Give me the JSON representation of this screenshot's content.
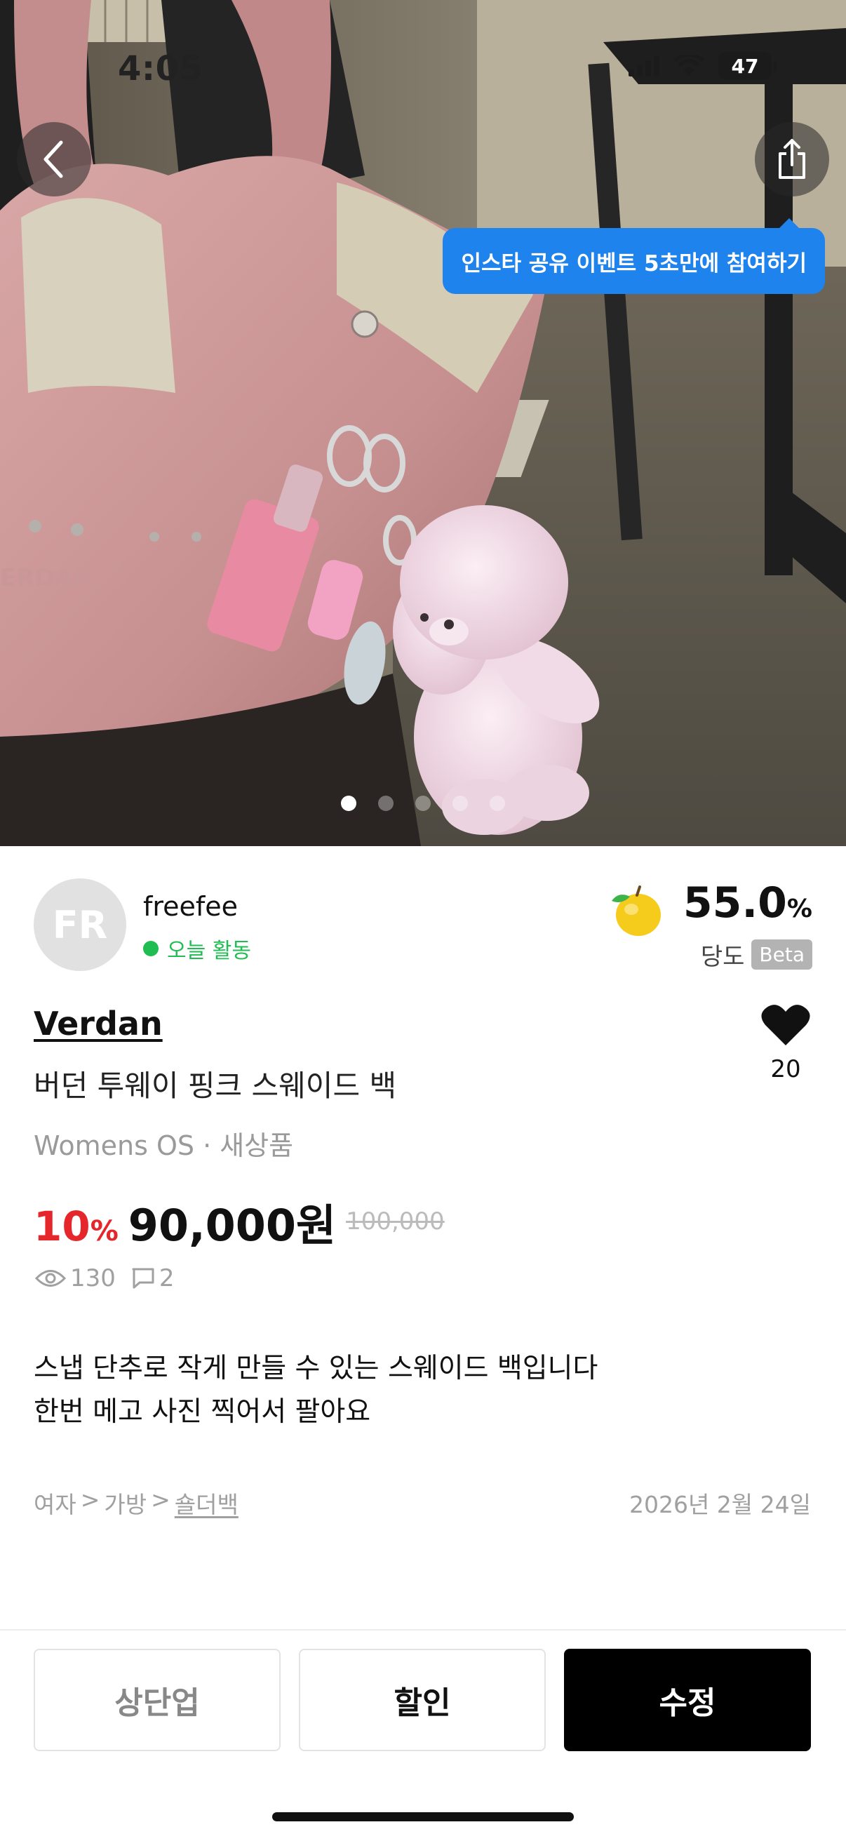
{
  "status_bar": {
    "time": "4:05",
    "battery": "47"
  },
  "hero": {
    "tooltip": "인스타 공유 이벤트 5초만에 참여하기",
    "page_count": 5,
    "active_index": 0,
    "bag_brand_text": "ERDAN"
  },
  "seller": {
    "avatar_initials": "FR",
    "name": "freefee",
    "activity": "오늘 활동",
    "score_value": "55.0",
    "score_unit": "%",
    "score_label": "당도",
    "score_badge": "Beta"
  },
  "product": {
    "brand": "Verdan",
    "title": "버던 투웨이 핑크 스웨이드 백",
    "meta": "Womens OS · 새상품",
    "discount": "10",
    "discount_unit": "%",
    "price": "90,000원",
    "original_price": "100,000",
    "likes": "20",
    "views": "130",
    "comments": "2",
    "description_line1": "스냅 단추로 작게 만들 수 있는 스웨이드 백입니다",
    "description_line2": "한번 메고 사진 찍어서 팔아요",
    "breadcrumb": [
      "여자",
      ">",
      "가방",
      ">",
      "숄더백"
    ],
    "date": "2026년 2월 24일"
  },
  "actions": {
    "bump": "상단업",
    "discount": "할인",
    "edit": "수정"
  },
  "colors": {
    "accent_blue": "#1f83ee",
    "discount_red": "#e5262b",
    "online_green": "#1fbd52"
  }
}
